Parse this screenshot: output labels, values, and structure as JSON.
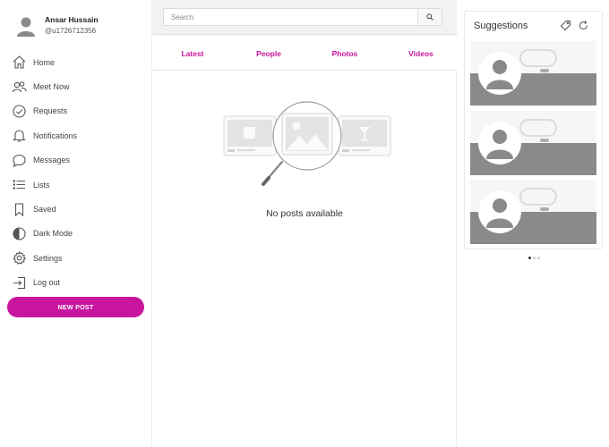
{
  "profile": {
    "name": "Ansar Hussain",
    "handle": "@u1726712356",
    "avatar_icon": "user-avatar-icon"
  },
  "nav": {
    "items": [
      {
        "label": "Home",
        "icon": "home-icon"
      },
      {
        "label": "Meet Now",
        "icon": "people-icon"
      },
      {
        "label": "Requests",
        "icon": "check-circle-icon"
      },
      {
        "label": "Notifications",
        "icon": "bell-icon"
      },
      {
        "label": "Messages",
        "icon": "chat-bubble-icon"
      },
      {
        "label": "Lists",
        "icon": "list-icon"
      },
      {
        "label": "Saved",
        "icon": "bookmark-icon"
      },
      {
        "label": "Dark Mode",
        "icon": "half-circle-icon"
      },
      {
        "label": "Settings",
        "icon": "gear-icon"
      },
      {
        "label": "Log out",
        "icon": "logout-icon"
      }
    ],
    "new_post_label": "NEW POST"
  },
  "search": {
    "placeholder": "Search",
    "value": ""
  },
  "tabs": [
    {
      "label": "Latest"
    },
    {
      "label": "People"
    },
    {
      "label": "Photos"
    },
    {
      "label": "Videos"
    }
  ],
  "feed": {
    "empty_message": "No posts available"
  },
  "suggestions": {
    "title": "Suggestions",
    "items_count": 3,
    "active_dot": 0
  },
  "colors": {
    "accent": "#c8159f",
    "cover": "#8a8a8a"
  }
}
